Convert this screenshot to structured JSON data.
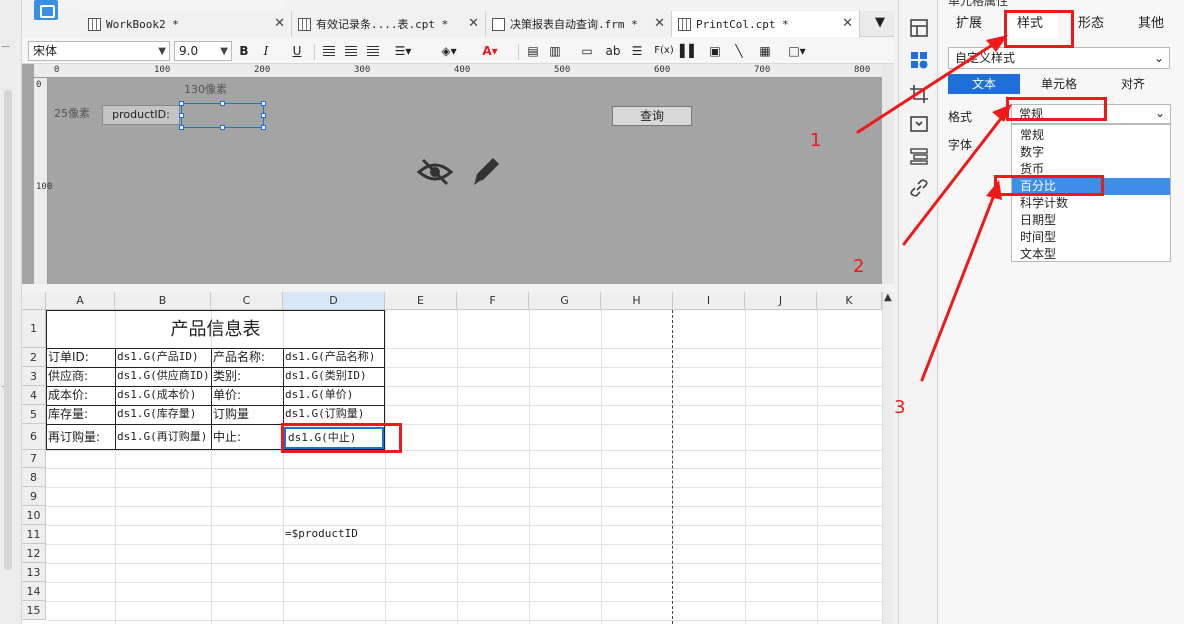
{
  "tabs": [
    {
      "title": "WorkBook2 *"
    },
    {
      "title": "有效记录条....表.cpt *"
    },
    {
      "title": "决策报表自动查询.frm *"
    },
    {
      "title": "PrintCol.cpt *"
    }
  ],
  "format_toolbar": {
    "font_family": "宋体",
    "font_size": "9.0",
    "bold": "B",
    "italic": "I",
    "underline": "U",
    "text_tool": "ab",
    "formula": "F(x)"
  },
  "ruler": {
    "top_marks": [
      "0",
      "100",
      "200",
      "300",
      "400",
      "500",
      "600",
      "700",
      "800"
    ],
    "left_marks": [
      "0",
      "100"
    ]
  },
  "design": {
    "width_hint": "130像素",
    "height_hint": "25像素",
    "label": "productID:",
    "query_button": "查询"
  },
  "sheet": {
    "columns": [
      "A",
      "B",
      "C",
      "D",
      "E",
      "F",
      "G",
      "H",
      "I",
      "J",
      "K"
    ],
    "rows": [
      "1",
      "2",
      "3",
      "4",
      "5",
      "6",
      "7",
      "8",
      "9",
      "10",
      "11",
      "12",
      "13",
      "14",
      "15"
    ],
    "title": "产品信息表",
    "cells": {
      "a2": "订单ID:",
      "b2": "ds1.G(产品ID)",
      "c2": "产品名称:",
      "d2": "ds1.G(产品名称)",
      "a3": "供应商:",
      "b3": "ds1.G(供应商ID)",
      "c3": "类别:",
      "d3": "ds1.G(类别ID)",
      "a4": "成本价:",
      "b4": "ds1.G(成本价)",
      "c4": "单价:",
      "d4": "ds1.G(单价)",
      "a5": "库存量:",
      "b5": "ds1.G(库存量)",
      "c5": "订购量",
      "d5": "ds1.G(订购量)",
      "a6": "再订购量:",
      "b6": "ds1.G(再订购量)",
      "c6": "中止:",
      "d6": "ds1.G(中止)",
      "d11": "=$productID"
    }
  },
  "panel": {
    "title": "单元格属性",
    "tabs": [
      "扩展",
      "样式",
      "形态",
      "其他"
    ],
    "active_tab": "样式",
    "style_select": "自定义样式",
    "subtabs": [
      "文本",
      "单元格",
      "对齐"
    ],
    "format_label": "格式",
    "font_label": "字体",
    "format_value": "常规",
    "format_options": [
      "常规",
      "数字",
      "货币",
      "百分比",
      "科学计数",
      "日期型",
      "时间型",
      "文本型"
    ],
    "highlighted_option": "百分比"
  },
  "annotations": [
    "1",
    "2",
    "3"
  ],
  "colors": {
    "accent": "#1e6fd9",
    "annotation": "#f01818",
    "highlight": "#3d8ee8"
  }
}
